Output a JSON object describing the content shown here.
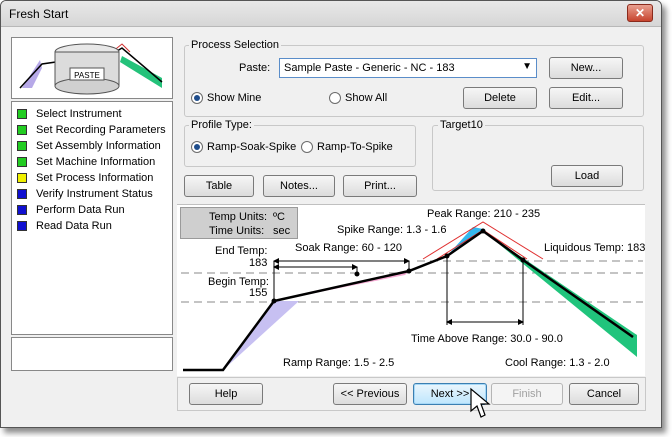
{
  "window": {
    "title": "Fresh Start"
  },
  "thumbnail": {
    "label": "PASTE"
  },
  "steps": [
    {
      "label": "Select Instrument",
      "color": "#22cc22"
    },
    {
      "label": "Set Recording Parameters",
      "color": "#22cc22"
    },
    {
      "label": "Set Assembly Information",
      "color": "#22cc22"
    },
    {
      "label": "Set Machine Information",
      "color": "#22cc22"
    },
    {
      "label": "Set Process Information",
      "color": "#f0f000"
    },
    {
      "label": "Verify Instrument Status",
      "color": "#1010d0"
    },
    {
      "label": "Perform Data Run",
      "color": "#1010d0"
    },
    {
      "label": "Read Data Run",
      "color": "#1010d0"
    }
  ],
  "process": {
    "group_label": "Process Selection",
    "paste_label": "Paste:",
    "paste_value": "Sample Paste - Generic - NC - 183",
    "new_button": "New...",
    "show_mine": "Show Mine",
    "show_all": "Show All",
    "show_selected": "mine",
    "delete_button": "Delete",
    "edit_button": "Edit..."
  },
  "profile": {
    "group_label": "Profile Type:",
    "option_1": "Ramp-Soak-Spike",
    "option_2": "Ramp-To-Spike",
    "selected": "ramp-soak-spike"
  },
  "target": {
    "group_label": "Target10",
    "load_button": "Load"
  },
  "actions": {
    "table": "Table",
    "notes": "Notes...",
    "print": "Print..."
  },
  "units": {
    "temp_label": "Temp Units:",
    "temp_value": "ºC",
    "time_label": "Time Units:",
    "time_value": "sec"
  },
  "diagram": {
    "peak_range": "Peak Range: 210 - 235",
    "spike_range": "Spike Range: 1.3 - 1.6",
    "end_temp_label": "End Temp:",
    "end_temp_value": "183",
    "soak_range": "Soak Range: 60 - 120",
    "begin_temp_label": "Begin Temp:",
    "begin_temp_value": "155",
    "liquidous_temp": "Liquidous Temp: 183",
    "time_above_range": "Time Above Range: 30.0 - 90.0",
    "ramp_range": "Ramp Range:  1.5 - 2.5",
    "cool_range": "Cool Range: 1.3 - 2.0"
  },
  "nav": {
    "help": "Help",
    "previous": "<< Previous",
    "next": "Next >>",
    "finish": "Finish",
    "cancel": "Cancel"
  }
}
